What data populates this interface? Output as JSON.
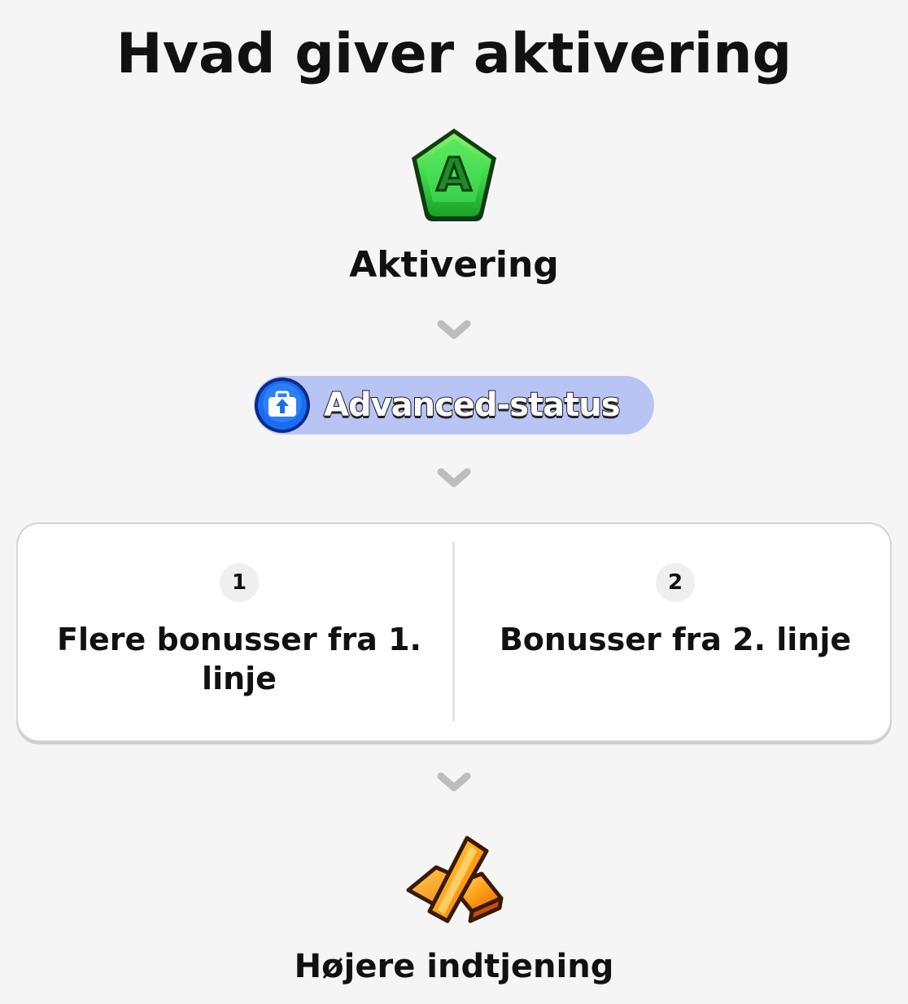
{
  "page": {
    "title": "Hvad giver aktivering"
  },
  "steps": {
    "activation": {
      "icon": "green-pentagon-a-icon",
      "label": "Aktivering",
      "icon_letter": "A"
    },
    "status": {
      "icon": "blue-briefcase-upgrade-icon",
      "label": "Advanced-status"
    },
    "benefits": [
      {
        "number": "1",
        "text": "Flere bonusser fra 1. linje"
      },
      {
        "number": "2",
        "text": "Bonusser fra 2. linje"
      }
    ],
    "result": {
      "icon": "gold-bars-icon",
      "label": "Højere indtjening"
    }
  },
  "colors": {
    "background": "#f5f5f5",
    "pill": "#b8c4f4",
    "green": "#3fd84a",
    "blue": "#1a6cf0",
    "gold": "#ffa21a",
    "chevron": "#bdbdbd"
  }
}
